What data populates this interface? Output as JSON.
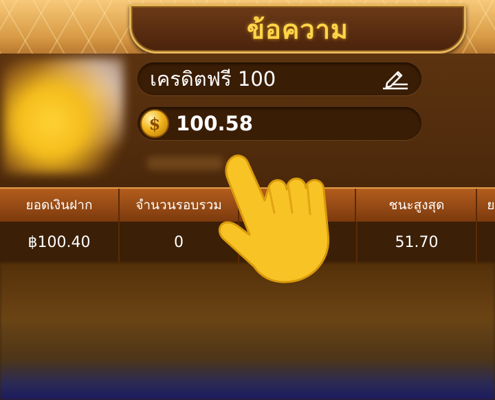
{
  "header": {
    "title": "ข้อความ"
  },
  "profile": {
    "name": "เครดิตฟรี 100",
    "balance": "100.58",
    "edit_icon": "pencil-edit-icon",
    "coin_icon": "coin-icon",
    "coin_symbol": "$"
  },
  "table": {
    "headers": [
      "ยอดเงินฝาก",
      "จำนวนรอบรวม",
      "ะ",
      "ชนะสูงสุด",
      "ย"
    ],
    "row": [
      "฿100.40",
      "0",
      "",
      "51.70",
      ""
    ]
  },
  "overlay": {
    "pointer_icon": "pointing-hand-icon"
  },
  "colors": {
    "title_gold": "#ffd54a",
    "panel_brown": "#4b280b",
    "header_orange": "#b35d1d"
  }
}
